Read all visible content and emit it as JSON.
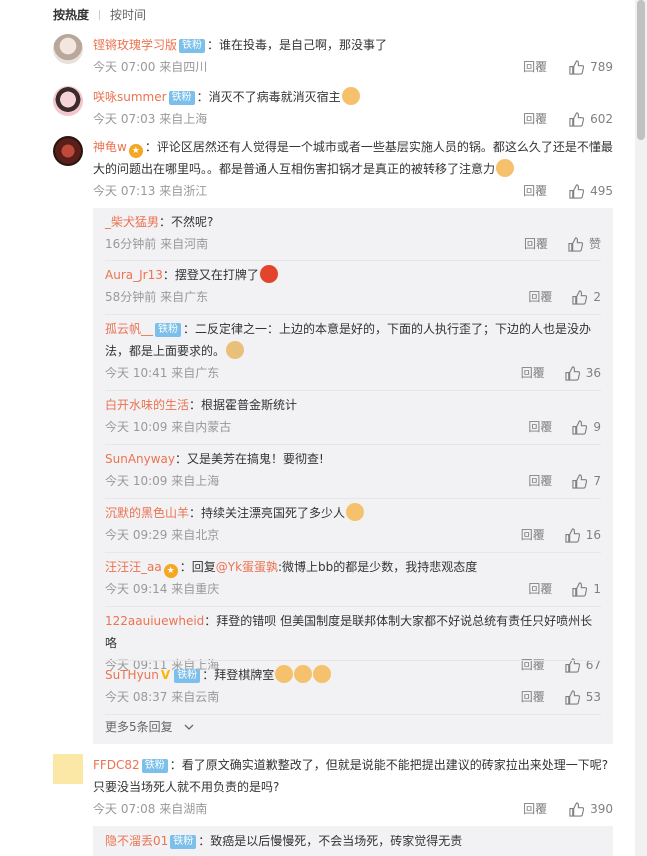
{
  "tabs": [
    "按热度",
    "按时间"
  ],
  "comments": [
    {
      "user": "铿锵玫瑰学习版",
      "badge": "铁粉",
      "text": "：谁在投毒，是自己啊，那没事了",
      "time": "今天 07:00 来自四川",
      "reply": "回覆",
      "likes": "789"
    },
    {
      "user": "咲咏summer",
      "badge": "铁粉",
      "text": "：消灭不了病毒就消灭宿主",
      "time": "今天 07:03 来自上海",
      "reply": "回覆",
      "likes": "602"
    },
    {
      "user": "神龟w",
      "text1": "：评论区居然还有人觉得是一个城市或者一些基层实施人员的锅。都这么久了还是不懂最",
      "text2": "大的问题出在哪里吗。。都是普通人互相伤害扣锅才是真正的被转移了注意力",
      "time": "今天 07:13 来自浙江",
      "reply": "回覆",
      "likes": "495",
      "replies": [
        {
          "user": "_柴犬猛男",
          "text": "：不然呢?",
          "time": "16分钟前 来自河南",
          "reply": "回覆",
          "likes": "赞"
        },
        {
          "user": "Aura_Jr13",
          "text": "：摆登又在打牌了",
          "time": "58分钟前 来自广东",
          "reply": "回覆",
          "likes": "2"
        },
        {
          "user": "孤云帆__",
          "badge": "铁粉",
          "text1": "：二反定律之一：上边的本意是好的，下面的人执行歪了；下边的人也是没办",
          "text2": "法，都是上面要求的。",
          "time": "今天 10:41 来自广东",
          "reply": "回覆",
          "likes": "36"
        },
        {
          "user": "白开水味的生活",
          "text": "：根据霍普金斯统计",
          "time": "今天 10:09 来自内蒙古",
          "reply": "回覆",
          "likes": "9"
        },
        {
          "user": "SunAnyway",
          "text": "：又是美芳在搞鬼！要彻查!",
          "time": "今天 10:09 来自上海",
          "reply": "回覆",
          "likes": "7"
        },
        {
          "user": "沉默的黑色山羊",
          "text": "：持续关注漂亮国死了多少人",
          "time": "今天 09:29 来自北京",
          "reply": "回覆",
          "likes": "16"
        },
        {
          "user": "汪汪汪_aa",
          "text_pre": "：回复",
          "mention": "@Yk蛋蛋孰",
          "text": ":微博上bb的都是少数，我持悲观态度",
          "time": "今天 09:14 来自重庆",
          "reply": "回覆",
          "likes": "1"
        },
        {
          "user": "122aauiuewheid",
          "text": "：拜登的错呗 但美国制度是联邦体制大家都不好说总统有责任只好喷州长咯",
          "time": "今天 09:11 来自上海",
          "reply": "回覆",
          "likes": "67"
        },
        {
          "user": "SuTHyun",
          "badge": "铁粉",
          "text": "：拜登棋牌室",
          "time": "今天 08:37 来自云南",
          "reply": "回覆",
          "likes": "53"
        }
      ],
      "more": "更多5条回复"
    },
    {
      "user": "FFDC82",
      "badge": "铁粉",
      "text1": "：看了原文确实道歉整改了，但就是说能不能把提出建议的砖家拉出来处理一下呢?",
      "text2": "只要没当场死人就不用负责的是吗?",
      "time": "今天 07:08 来自湖南",
      "reply": "回覆",
      "likes": "390",
      "replies": [
        {
          "user": "隐不溜丢01",
          "badge": "铁粉",
          "text": "：致癌是以后慢慢死，不会当场死，砖家觉得无责"
        }
      ]
    }
  ],
  "colors": {
    "username": "#eb7350",
    "badge": "#7bbfea",
    "meta": "#999999",
    "reply_bg": "#f2f2f5"
  },
  "icons": [
    "thumb-up-icon",
    "chevron-down-icon",
    "vip-crown-icon",
    "verified-v-icon"
  ]
}
